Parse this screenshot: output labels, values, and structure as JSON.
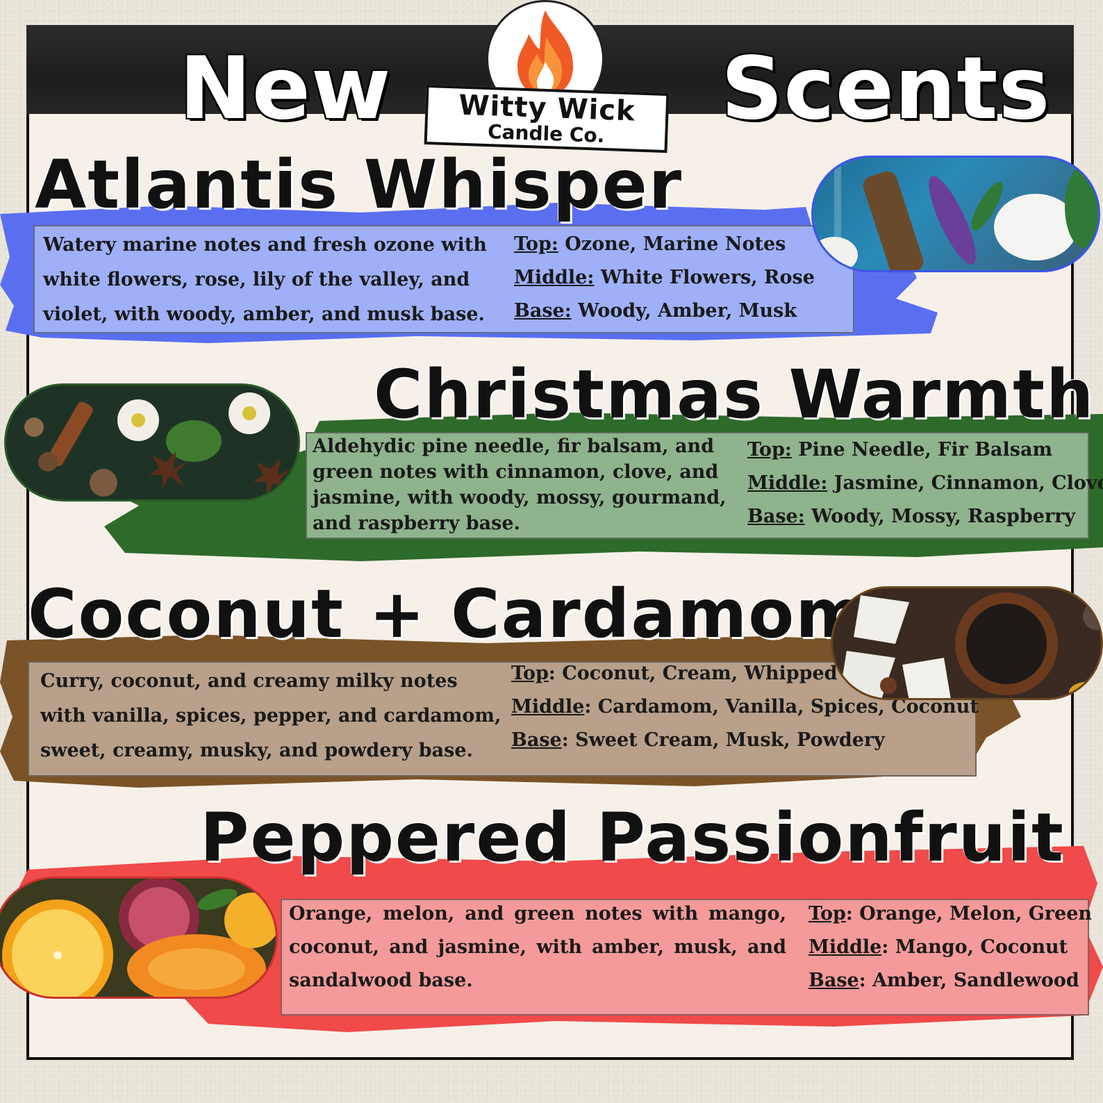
{
  "header": {
    "word_left": "New",
    "word_right": "Scents"
  },
  "logo": {
    "name": "Witty Wick",
    "subtitle": "Candle Co."
  },
  "colors": {
    "blue": "#5a6ff0",
    "green": "#2e6a2a",
    "brown": "#7b5328",
    "red": "#f04a4a"
  },
  "scents": [
    {
      "name": "Atlantis Whisper",
      "description": "Watery marine notes and fresh ozone with white flowers, rose, lily of the valley, and violet, with woody, amber, and musk base.",
      "top_label": "Top:",
      "top": "Ozone, Marine Notes",
      "middle_label": "Middle:",
      "middle": "White Flowers, Rose",
      "base_label": "Base:",
      "base": "Woody, Amber, Musk",
      "image": "driftwood-and-flowers-photo"
    },
    {
      "name": "Christmas Warmth",
      "description": "Aldehydic pine needle, fir balsam, and green notes with cinnamon, clove, and jasmine, with woody, mossy, gourmand, and raspberry base.",
      "top_label": "Top:",
      "top": "Pine Needle, Fir Balsam",
      "middle_label": "Middle:",
      "middle": "Jasmine, Cinnamon, Clove",
      "base_label": "Base:",
      "base": "Woody, Mossy, Raspberry",
      "image": "pine-and-spices-photo"
    },
    {
      "name": "Coconut + Cardamom",
      "description": "Curry, coconut, and creamy milky notes with vanilla, spices, pepper, and cardamom, sweet, creamy, musky, and powdery base.",
      "top_label": "Top",
      "top": ": Coconut, Cream, Whipped",
      "middle_label": "Middle",
      "middle": ": Cardamom, Vanilla, Spices, Coconut",
      "base_label": "Base",
      "base": ": Sweet Cream, Musk, Powdery",
      "image": "coconut-and-pepper-photo"
    },
    {
      "name": "Peppered Passionfruit",
      "description": "Orange, melon, and green notes with mango, coconut, and jasmine, with amber, musk, and sandalwood base.",
      "top_label": "Top",
      "top": ": Orange, Melon, Green",
      "middle_label": "Middle",
      "middle": ": Mango, Coconut",
      "base_label": "Base",
      "base": ": Amber, Sandlewood",
      "image": "tropical-fruit-photo"
    }
  ]
}
